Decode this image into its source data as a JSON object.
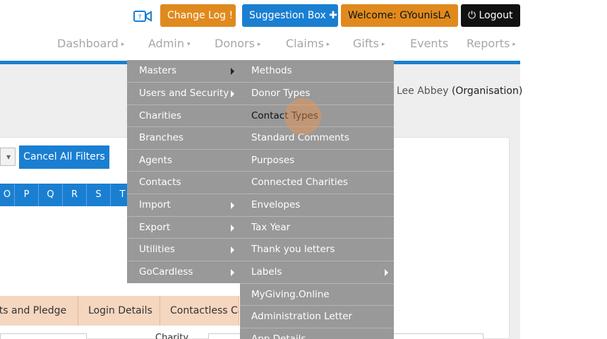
{
  "topbar": {
    "change_log": "Change Log !",
    "suggestion_box": "Suggestion Box ✚",
    "welcome": "Welcome:  GYounisLA",
    "logout": "⏻ Logout"
  },
  "nav": {
    "items": [
      {
        "label": "Dashboard",
        "caret": "▸"
      },
      {
        "label": "Admin",
        "caret": "▾"
      },
      {
        "label": "Donors",
        "caret": "▸"
      },
      {
        "label": "Claims",
        "caret": "▸"
      },
      {
        "label": "Gifts",
        "caret": "▸"
      },
      {
        "label": "Events",
        "caret": ""
      },
      {
        "label": "Reports",
        "caret": "▸"
      }
    ]
  },
  "org": {
    "name": "Lee Abbey",
    "type": "(Organisation)"
  },
  "filters": {
    "cancel_all": "Cancel All Filters"
  },
  "alphabet": [
    "O",
    "P",
    "Q",
    "R",
    "S",
    "T"
  ],
  "tabs": [
    "ults and Pledge",
    "Login Details",
    "Contactless Car"
  ],
  "bottom": {
    "charity_label": "Charity"
  },
  "admin_menu": {
    "col1": [
      {
        "label": "Masters",
        "submenu": true
      },
      {
        "label": "Users and Security",
        "submenu": true
      },
      {
        "label": "Charities",
        "submenu": false
      },
      {
        "label": "Branches",
        "submenu": false
      },
      {
        "label": "Agents",
        "submenu": false
      },
      {
        "label": "Contacts",
        "submenu": false
      },
      {
        "label": "Import",
        "submenu": true
      },
      {
        "label": "Export",
        "submenu": true
      },
      {
        "label": "Utilities",
        "submenu": true
      },
      {
        "label": "GoCardless",
        "submenu": true
      }
    ],
    "col2": [
      {
        "label": "Methods",
        "submenu": false
      },
      {
        "label": "Donor Types",
        "submenu": false
      },
      {
        "label": "Contact Types",
        "submenu": false
      },
      {
        "label": "Standard Comments",
        "submenu": false
      },
      {
        "label": "Purposes",
        "submenu": false
      },
      {
        "label": "Connected Charities",
        "submenu": false
      },
      {
        "label": "Envelopes",
        "submenu": false
      },
      {
        "label": "Tax Year",
        "submenu": false
      },
      {
        "label": "Thank you letters",
        "submenu": false
      },
      {
        "label": "Labels",
        "submenu": true
      },
      {
        "label": "MyGiving.Online",
        "submenu": false
      },
      {
        "label": "Administration Letter",
        "submenu": false
      },
      {
        "label": "App Details",
        "submenu": false
      }
    ]
  },
  "colors": {
    "primary": "#1a7fd1",
    "accent": "#e08a1e",
    "menu_bg": "#999999",
    "tab_bg": "#f5d6bf"
  }
}
